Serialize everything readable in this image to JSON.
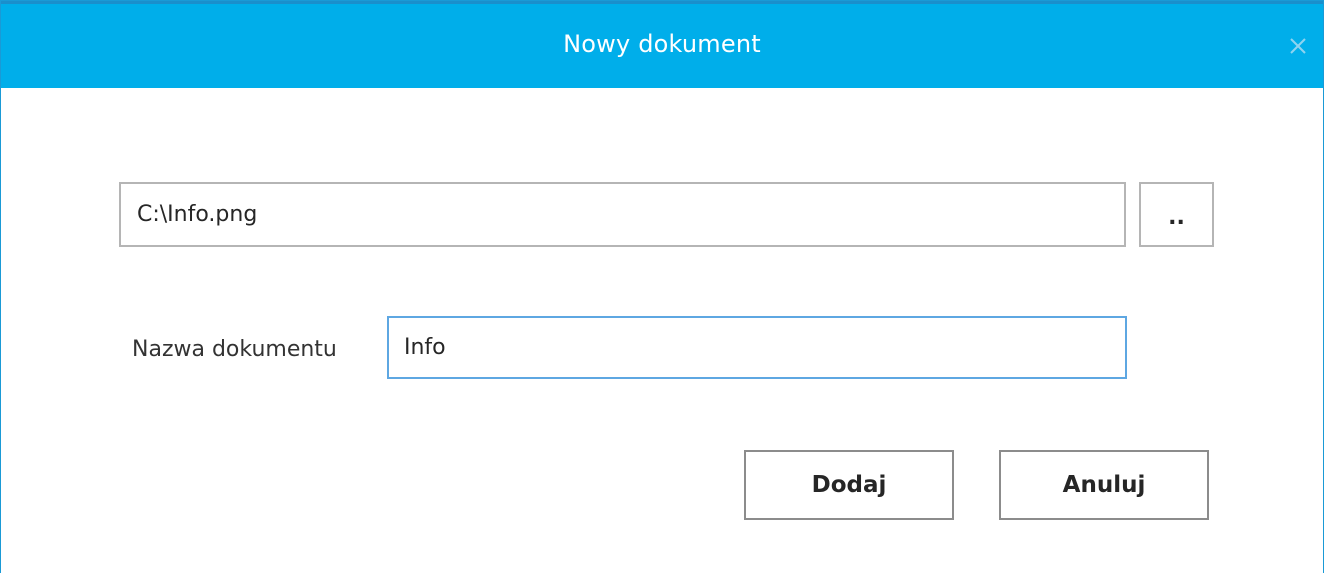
{
  "dialog": {
    "title": "Nowy dokument",
    "close_icon": "close-icon"
  },
  "file": {
    "path_value": "C:\\Info.png",
    "browse_label": ".."
  },
  "document_name": {
    "label": "Nazwa dokumentu",
    "value": "Info"
  },
  "actions": {
    "add_label": "Dodaj",
    "cancel_label": "Anuluj"
  },
  "colors": {
    "titlebar": "#00aeea",
    "focus_border": "#5ea7e2"
  }
}
